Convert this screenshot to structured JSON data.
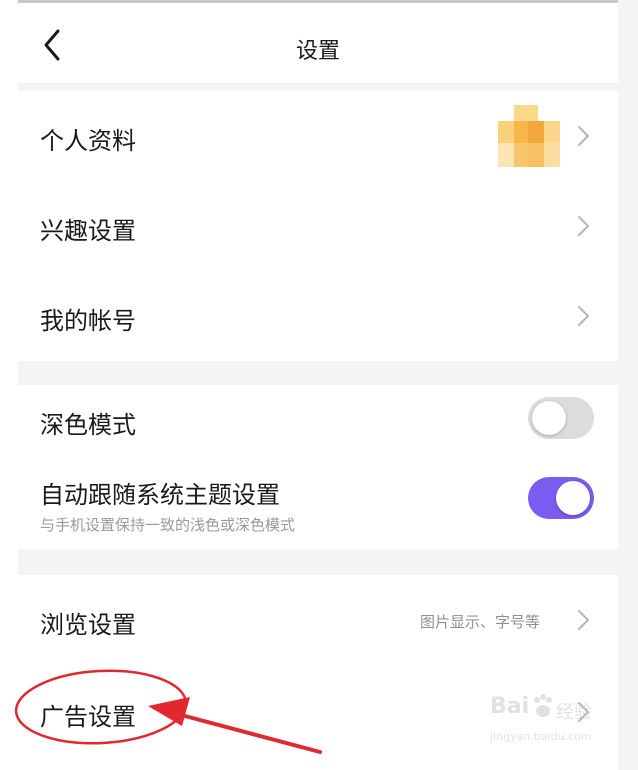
{
  "header": {
    "title": "设置",
    "back_icon": "chevron-left-icon"
  },
  "profile_group": {
    "items": [
      {
        "label": "个人资料",
        "has_avatar": true,
        "chevron": "chevron-right-icon"
      },
      {
        "label": "兴趣设置",
        "chevron": "chevron-right-icon"
      },
      {
        "label": "我的帐号",
        "chevron": "chevron-right-icon"
      }
    ]
  },
  "theme_group": {
    "dark_mode": {
      "label": "深色模式",
      "enabled": false
    },
    "follow_system": {
      "label": "自动跟随系统主题设置",
      "subtitle": "与手机设置保持一致的浅色或深色模式",
      "enabled": true
    }
  },
  "misc_group": {
    "items": [
      {
        "label": "浏览设置",
        "hint": "图片显示、字号等",
        "chevron": "chevron-right-icon"
      },
      {
        "label": "广告设置",
        "chevron": "chevron-right-icon"
      }
    ]
  },
  "annotation": {
    "color": "#e0282e",
    "target": "广告设置"
  },
  "watermark": {
    "brand": "Bai",
    "brand_suffix": "经验",
    "url": "jingyan.baidu.com"
  },
  "colors": {
    "accent": "#7b5cf0",
    "toggle_off": "#dcdcdc",
    "section_gap": "#f4f4f5",
    "secondary_text": "#9a9a9a"
  }
}
